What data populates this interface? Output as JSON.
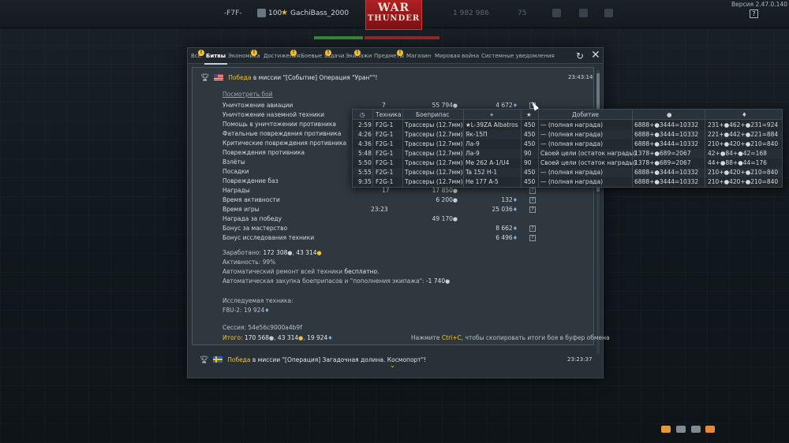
{
  "topbar": {
    "squad_tag": "-F7F-",
    "level": "100",
    "username": "GachiBass_2000",
    "logo_line1": "WAR",
    "logo_line2": "THUNDER",
    "silver_lions": "1 982 986",
    "golden_eagles": "75",
    "version": "Версия 2.47.0.140",
    "help": "?"
  },
  "modal": {
    "tabs": [
      {
        "label": "Все",
        "warn": false
      },
      {
        "label": "Битвы",
        "warn": true,
        "active": true
      },
      {
        "label": "Экономика",
        "warn": true
      },
      {
        "label": "Достижения",
        "warn": true
      },
      {
        "label": "Боевые задачи",
        "warn": true
      },
      {
        "label": "Экипажи",
        "warn": true
      },
      {
        "label": "Предметы",
        "warn": true
      },
      {
        "label": "Магазин",
        "warn": false
      },
      {
        "label": "Мировая война",
        "warn": false
      },
      {
        "label": "Системные уведомления",
        "warn": false
      }
    ],
    "warn_mark": "!",
    "refresh_icon": "↻",
    "close_icon": "✕"
  },
  "battle1": {
    "victory": "Победа",
    "mission_text": " в миссии \"[Событие] Операция \"Уран\"\"!",
    "time": "23:43:14",
    "view_battle": "Посмотреть бой",
    "rows": [
      {
        "label": "Уничтожение авиации",
        "count": "7",
        "sl": "55 794",
        "rp": "4 672",
        "q": "?"
      },
      {
        "label": "Уничтожение наземной техники",
        "count": "",
        "sl": "",
        "rp": "",
        "q": ""
      },
      {
        "label": "Помощь в уничтожении противника",
        "count": "",
        "sl": "",
        "rp": "",
        "q": ""
      },
      {
        "label": "Фатальные повреждения противника",
        "count": "",
        "sl": "",
        "rp": "",
        "q": ""
      },
      {
        "label": "Критические повреждения противника",
        "count": "",
        "sl": "",
        "rp": "",
        "q": ""
      },
      {
        "label": "Повреждения противника",
        "count": "",
        "sl": "",
        "rp": "",
        "q": ""
      },
      {
        "label": "Взлёты",
        "count": "",
        "sl": "",
        "rp": "",
        "q": ""
      },
      {
        "label": "Посадки",
        "count": "",
        "sl": "",
        "rp": "",
        "q": ""
      },
      {
        "label": "Повреждение баз",
        "count": "",
        "sl": "",
        "rp": "",
        "q": ""
      },
      {
        "label": "Награды",
        "count": "17",
        "sl": "17 850",
        "rp": "",
        "q": "?"
      },
      {
        "label": "Время активности",
        "count": "",
        "sl": "6 200",
        "rp": "132",
        "q": "?"
      },
      {
        "label": "Время игры",
        "count": "23:23",
        "sl": "",
        "rp": "25 036",
        "q": "?"
      },
      {
        "label": "Награда за победу",
        "count": "",
        "sl": "49 170",
        "rp": "",
        "q": ""
      },
      {
        "label": "Бонус за мастерство",
        "count": "",
        "sl": "",
        "rp": "8 662",
        "q": "?"
      },
      {
        "label": "Бонус исследования техники",
        "count": "",
        "sl": "",
        "rp": "6 496",
        "q": "?"
      }
    ],
    "earned_label": "Заработано: ",
    "earned_sl": "172 308",
    "earned_gold": "43 314",
    "activity": "Активность: 99%",
    "repair_text": "Автоматический ремонт всей техники ",
    "repair_free": "бесплатно.",
    "restock_text": "Автоматическая закупка боеприпасов и \"пополнения экипажа\": ",
    "restock_value": "-1 740",
    "researched_label": "Исследуемая техника:",
    "researched_vehicle": "F8U-2: ",
    "researched_rp": "19 924",
    "session": "Сессия: 54e56c9000a4b9f",
    "total_label": "Итого: ",
    "total_sl": "170 568",
    "total_gold": "43 314",
    "total_rp": "19 924",
    "copy_hint_pre": "Нажмите ",
    "copy_hint_key": "Ctrl+C",
    "copy_hint_post": ", чтобы скопировать итоги боя в буфер обмена"
  },
  "battle2": {
    "victory": "Победа",
    "mission_text": " в миссии \"[Операция] Загадочная долина. Космопорт\"!",
    "time": "23:23:37"
  },
  "tooltip": {
    "headers": {
      "time_icon": "◷",
      "vehicle": "Техника",
      "ammo": "Боеприпас",
      "target_icon": "⌖",
      "star_icon": "★",
      "finish": "Добитие",
      "sl_icon": "●",
      "rp_icon": "♦"
    },
    "rows": [
      {
        "time": "2:59",
        "vehicle": "F2G-1",
        "ammo": "Трассеры (12.7мм)",
        "target": "★L-39ZA Albatros",
        "score": "450",
        "finish": "— (полная награда)",
        "sl": "6888+●3444=10332",
        "rp": "231+●462+●231=924"
      },
      {
        "time": "4:26",
        "vehicle": "F2G-1",
        "ammo": "Трассеры (12.7мм)",
        "target": "Як-15П",
        "score": "450",
        "finish": "— (полная награда)",
        "sl": "6888+●3444=10332",
        "rp": "221+●442+●221=884"
      },
      {
        "time": "4:36",
        "vehicle": "F2G-1",
        "ammo": "Трассеры (12.7мм)",
        "target": "Ла-9",
        "score": "450",
        "finish": "— (полная награда)",
        "sl": "6888+●3444=10332",
        "rp": "210+●420+●210=840"
      },
      {
        "time": "5:48",
        "vehicle": "F2G-1",
        "ammo": "Трассеры (12.7мм)",
        "target": "Ла-9",
        "score": "90",
        "finish": "Своей цели (остаток награды)",
        "sl": "1378+●689=2067",
        "rp": "42+●84+●42=168"
      },
      {
        "time": "5:50",
        "vehicle": "F2G-1",
        "ammo": "Трассеры (12.7мм)",
        "target": "Me 262 A-1/U4",
        "score": "90",
        "finish": "Своей цели (остаток награды)",
        "sl": "1378+●689=2067",
        "rp": "44+●88+●44=176"
      },
      {
        "time": "5:55",
        "vehicle": "F2G-1",
        "ammo": "Трассеры (12.7мм)",
        "target": "Ta 152 H-1",
        "score": "450",
        "finish": "— (полная награда)",
        "sl": "6888+●3444=10332",
        "rp": "210+●420+●210=840"
      },
      {
        "time": "9:35",
        "vehicle": "F2G-1",
        "ammo": "Трассеры (12.7мм)",
        "target": "He 177 A-5",
        "score": "450",
        "finish": "— (полная награда)",
        "sl": "6888+●3444=10332",
        "rp": "210+●420+●210=840"
      }
    ]
  },
  "icons": {
    "trophy": "🏆︎",
    "sl": "●",
    "rp": "♦",
    "gold": "●",
    "chevron": "⌄",
    "star": "★"
  },
  "colors": {
    "accent": "#f1c232",
    "rp_blue": "#7fb3e6",
    "modal_bg": "#283138",
    "logo_red": "#b02024"
  }
}
